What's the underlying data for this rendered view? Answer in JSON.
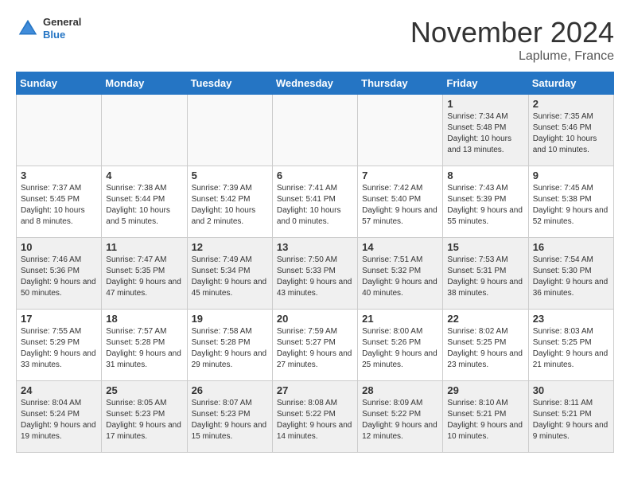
{
  "header": {
    "logo_general": "General",
    "logo_blue": "Blue",
    "month_title": "November 2024",
    "location": "Laplume, France"
  },
  "days_of_week": [
    "Sunday",
    "Monday",
    "Tuesday",
    "Wednesday",
    "Thursday",
    "Friday",
    "Saturday"
  ],
  "weeks": [
    [
      {
        "day": "",
        "empty": true
      },
      {
        "day": "",
        "empty": true
      },
      {
        "day": "",
        "empty": true
      },
      {
        "day": "",
        "empty": true
      },
      {
        "day": "",
        "empty": true
      },
      {
        "day": "1",
        "sunrise": "7:34 AM",
        "sunset": "5:48 PM",
        "daylight": "10 hours and 13 minutes."
      },
      {
        "day": "2",
        "sunrise": "7:35 AM",
        "sunset": "5:46 PM",
        "daylight": "10 hours and 10 minutes."
      }
    ],
    [
      {
        "day": "3",
        "sunrise": "7:37 AM",
        "sunset": "5:45 PM",
        "daylight": "10 hours and 8 minutes."
      },
      {
        "day": "4",
        "sunrise": "7:38 AM",
        "sunset": "5:44 PM",
        "daylight": "10 hours and 5 minutes."
      },
      {
        "day": "5",
        "sunrise": "7:39 AM",
        "sunset": "5:42 PM",
        "daylight": "10 hours and 2 minutes."
      },
      {
        "day": "6",
        "sunrise": "7:41 AM",
        "sunset": "5:41 PM",
        "daylight": "10 hours and 0 minutes."
      },
      {
        "day": "7",
        "sunrise": "7:42 AM",
        "sunset": "5:40 PM",
        "daylight": "9 hours and 57 minutes."
      },
      {
        "day": "8",
        "sunrise": "7:43 AM",
        "sunset": "5:39 PM",
        "daylight": "9 hours and 55 minutes."
      },
      {
        "day": "9",
        "sunrise": "7:45 AM",
        "sunset": "5:38 PM",
        "daylight": "9 hours and 52 minutes."
      }
    ],
    [
      {
        "day": "10",
        "sunrise": "7:46 AM",
        "sunset": "5:36 PM",
        "daylight": "9 hours and 50 minutes."
      },
      {
        "day": "11",
        "sunrise": "7:47 AM",
        "sunset": "5:35 PM",
        "daylight": "9 hours and 47 minutes."
      },
      {
        "day": "12",
        "sunrise": "7:49 AM",
        "sunset": "5:34 PM",
        "daylight": "9 hours and 45 minutes."
      },
      {
        "day": "13",
        "sunrise": "7:50 AM",
        "sunset": "5:33 PM",
        "daylight": "9 hours and 43 minutes."
      },
      {
        "day": "14",
        "sunrise": "7:51 AM",
        "sunset": "5:32 PM",
        "daylight": "9 hours and 40 minutes."
      },
      {
        "day": "15",
        "sunrise": "7:53 AM",
        "sunset": "5:31 PM",
        "daylight": "9 hours and 38 minutes."
      },
      {
        "day": "16",
        "sunrise": "7:54 AM",
        "sunset": "5:30 PM",
        "daylight": "9 hours and 36 minutes."
      }
    ],
    [
      {
        "day": "17",
        "sunrise": "7:55 AM",
        "sunset": "5:29 PM",
        "daylight": "9 hours and 33 minutes."
      },
      {
        "day": "18",
        "sunrise": "7:57 AM",
        "sunset": "5:28 PM",
        "daylight": "9 hours and 31 minutes."
      },
      {
        "day": "19",
        "sunrise": "7:58 AM",
        "sunset": "5:28 PM",
        "daylight": "9 hours and 29 minutes."
      },
      {
        "day": "20",
        "sunrise": "7:59 AM",
        "sunset": "5:27 PM",
        "daylight": "9 hours and 27 minutes."
      },
      {
        "day": "21",
        "sunrise": "8:00 AM",
        "sunset": "5:26 PM",
        "daylight": "9 hours and 25 minutes."
      },
      {
        "day": "22",
        "sunrise": "8:02 AM",
        "sunset": "5:25 PM",
        "daylight": "9 hours and 23 minutes."
      },
      {
        "day": "23",
        "sunrise": "8:03 AM",
        "sunset": "5:25 PM",
        "daylight": "9 hours and 21 minutes."
      }
    ],
    [
      {
        "day": "24",
        "sunrise": "8:04 AM",
        "sunset": "5:24 PM",
        "daylight": "9 hours and 19 minutes."
      },
      {
        "day": "25",
        "sunrise": "8:05 AM",
        "sunset": "5:23 PM",
        "daylight": "9 hours and 17 minutes."
      },
      {
        "day": "26",
        "sunrise": "8:07 AM",
        "sunset": "5:23 PM",
        "daylight": "9 hours and 15 minutes."
      },
      {
        "day": "27",
        "sunrise": "8:08 AM",
        "sunset": "5:22 PM",
        "daylight": "9 hours and 14 minutes."
      },
      {
        "day": "28",
        "sunrise": "8:09 AM",
        "sunset": "5:22 PM",
        "daylight": "9 hours and 12 minutes."
      },
      {
        "day": "29",
        "sunrise": "8:10 AM",
        "sunset": "5:21 PM",
        "daylight": "9 hours and 10 minutes."
      },
      {
        "day": "30",
        "sunrise": "8:11 AM",
        "sunset": "5:21 PM",
        "daylight": "9 hours and 9 minutes."
      }
    ]
  ]
}
